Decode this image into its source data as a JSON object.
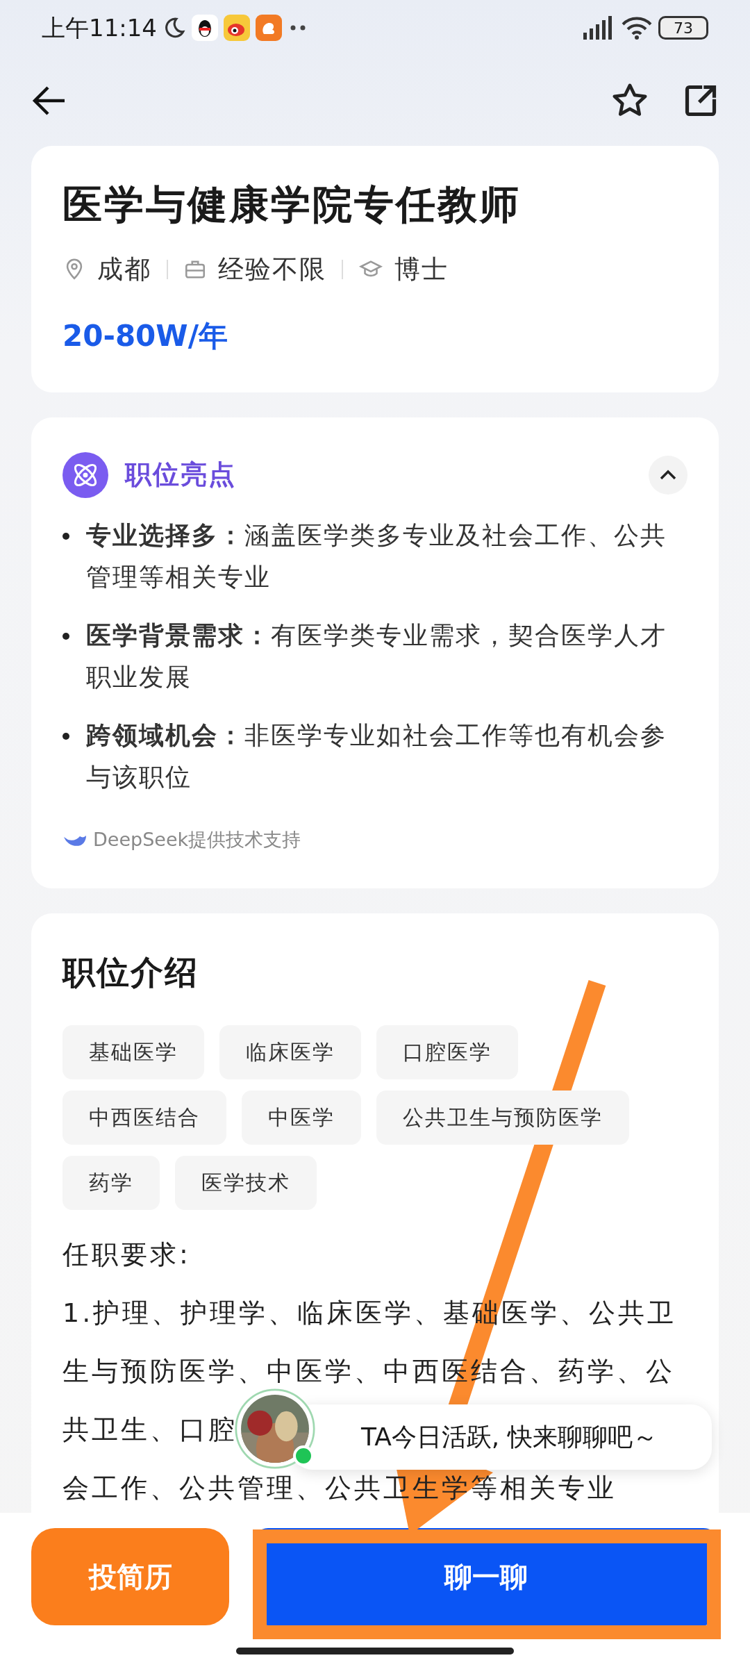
{
  "status_bar": {
    "time": "上午11:14",
    "battery": "73"
  },
  "job": {
    "title": "医学与健康学院专任教师",
    "meta": [
      {
        "kind": "location",
        "text": "成都"
      },
      {
        "kind": "experience",
        "text": "经验不限"
      },
      {
        "kind": "degree",
        "text": "博士"
      }
    ],
    "salary": "20-80W/年"
  },
  "highlights": {
    "title": "职位亮点",
    "expanded": true,
    "items": [
      {
        "text": "**专业选择多：**涵盖医学类多专业及社会工作、公共管理等相关专业"
      },
      {
        "text": "**医学背景需求：**有医学类专业需求，契合医学人才职业发展"
      },
      {
        "text": "**跨领域机会：**非医学专业如社会工作等也有机会参与该职位"
      }
    ],
    "footer": "DeepSeek提供技术支持"
  },
  "intro": {
    "title": "职位介绍",
    "tags": [
      "基础医学",
      "临床医学",
      "口腔医学",
      "中西医结合",
      "中医学",
      "公共卫生与预防医学",
      "药学",
      "医学技术"
    ],
    "requirements_heading": "任职要求:",
    "requirements_lines": [
      "1.护理、护理学、临床医学、基础医学、公共卫",
      "生与预防医学、中医学、中西医结合、药学、公",
      "共卫生、口腔",
      "会工作、公共管理、公共卫生学等相关专业"
    ]
  },
  "chat_prompt": {
    "text": "TA今日活跃, 快来聊聊吧～",
    "online": true
  },
  "buttons": [
    {
      "kind": "secondary",
      "label": "投简历"
    },
    {
      "kind": "primary",
      "label": "聊一聊"
    }
  ]
}
